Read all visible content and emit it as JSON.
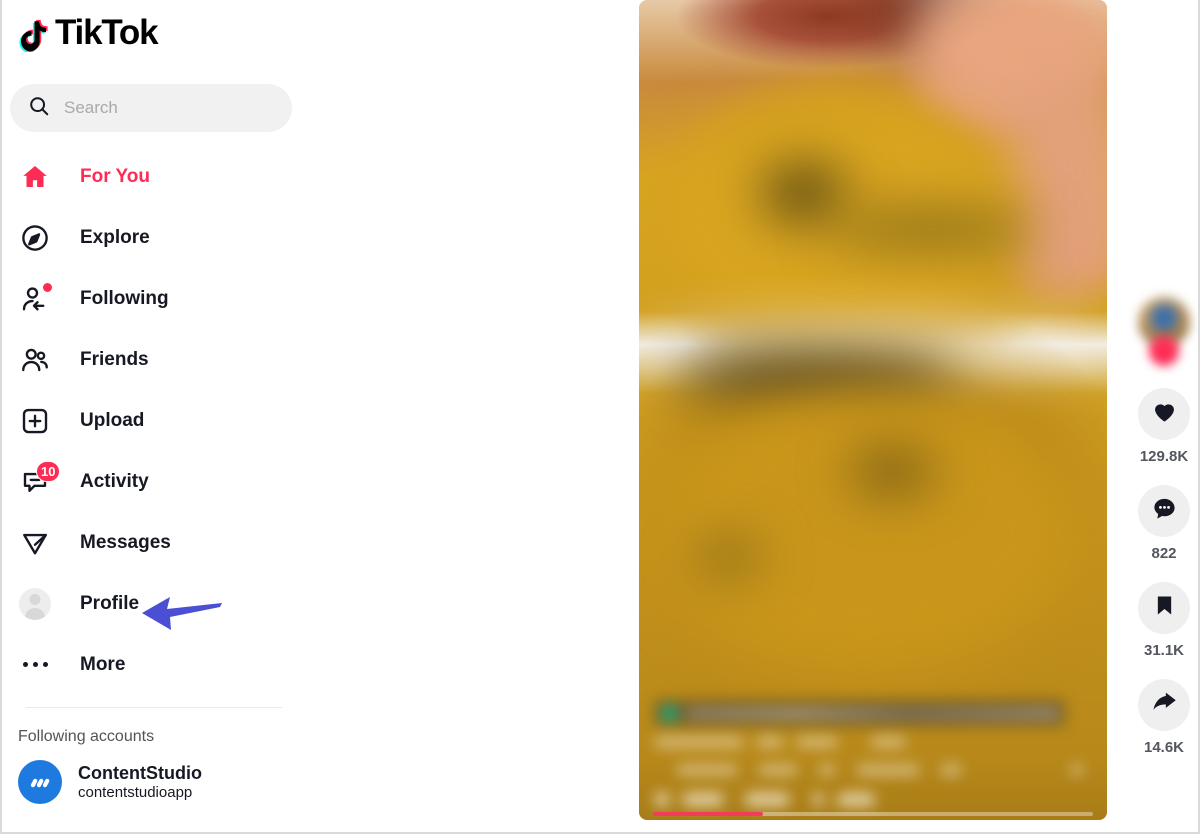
{
  "app": {
    "brand": "TikTok",
    "accent_red": "#FE2C55",
    "accent_cyan": "#25F4EE",
    "annotation_arrow_color": "#4B4FD4"
  },
  "search": {
    "placeholder": "Search",
    "value": "",
    "icon": "search-icon"
  },
  "sidebar": {
    "items": [
      {
        "label": "For You",
        "icon": "home-icon",
        "active": true,
        "badge": ""
      },
      {
        "label": "Explore",
        "icon": "compass-icon",
        "active": false,
        "badge": ""
      },
      {
        "label": "Following",
        "icon": "user-follow-icon",
        "active": false,
        "badge": "dot"
      },
      {
        "label": "Friends",
        "icon": "friends-icon",
        "active": false,
        "badge": ""
      },
      {
        "label": "Upload",
        "icon": "plus-box-icon",
        "active": false,
        "badge": ""
      },
      {
        "label": "Activity",
        "icon": "activity-icon",
        "active": false,
        "badge": "10"
      },
      {
        "label": "Messages",
        "icon": "send-icon",
        "active": false,
        "badge": ""
      },
      {
        "label": "Profile",
        "icon": "avatar-icon",
        "active": false,
        "badge": ""
      },
      {
        "label": "More",
        "icon": "ellipsis-icon",
        "active": false,
        "badge": ""
      }
    ],
    "following_section": {
      "title": "Following accounts",
      "accounts": [
        {
          "name": "ContentStudio",
          "handle": "contentstudioapp",
          "avatar_color": "#1F7AE0"
        }
      ]
    }
  },
  "video": {
    "description": "blurred video of a hand holding a mustard yellow handbag",
    "caption_blurred": true,
    "progress_percent": 25
  },
  "action_rail": {
    "avatar": "creator-avatar",
    "follow_button": "follow-button",
    "actions": [
      {
        "name": "like",
        "icon": "heart-icon",
        "count": "129.8K"
      },
      {
        "name": "comment",
        "icon": "comment-icon",
        "count": "822"
      },
      {
        "name": "bookmark",
        "icon": "bookmark-icon",
        "count": "31.1K"
      },
      {
        "name": "share",
        "icon": "share-icon",
        "count": "14.6K"
      }
    ]
  }
}
